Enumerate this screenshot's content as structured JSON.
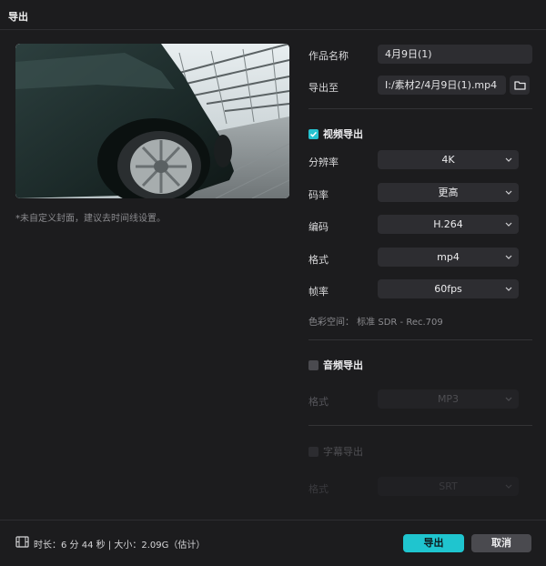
{
  "window": {
    "title": "导出"
  },
  "cover": {
    "hint": "*未自定义封面，建议去时间线设置。"
  },
  "work_name": {
    "label": "作品名称",
    "value": "4月9日(1)"
  },
  "export_to": {
    "label": "导出至",
    "value": "I:/素材2/4月9日(1).mp4",
    "folder_icon": "folder-icon"
  },
  "video": {
    "section_label": "视频导出",
    "checked": true,
    "resolution": {
      "label": "分辨率",
      "value": "4K"
    },
    "bitrate": {
      "label": "码率",
      "value": "更高"
    },
    "codec": {
      "label": "编码",
      "value": "H.264"
    },
    "format": {
      "label": "格式",
      "value": "mp4"
    },
    "framerate": {
      "label": "帧率",
      "value": "60fps"
    },
    "color_space": "色彩空间：  标准 SDR - Rec.709"
  },
  "audio": {
    "section_label": "音频导出",
    "checked": false,
    "format": {
      "label": "格式",
      "value": "MP3"
    }
  },
  "subtitle": {
    "section_label": "字幕导出",
    "checked": false,
    "format": {
      "label": "格式",
      "value": "SRT"
    }
  },
  "footer": {
    "stats": "时长：6 分 44 秒 | 大小：2.09G（估计）",
    "export_button": "导出",
    "cancel_button": "取消"
  },
  "colors": {
    "accent": "#1fc5cf",
    "background": "#1c1c1e",
    "field": "#2d2d31"
  }
}
